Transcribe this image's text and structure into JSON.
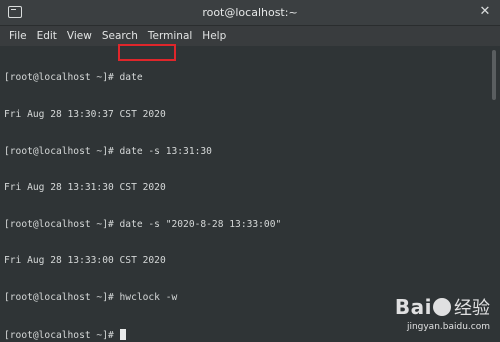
{
  "window": {
    "title": "root@localhost:~",
    "icon": "terminal-icon",
    "close_glyph": "✕"
  },
  "menu": {
    "items": [
      "File",
      "Edit",
      "View",
      "Search",
      "Terminal",
      "Help"
    ]
  },
  "terminal": {
    "lines": [
      "[root@localhost ~]# date",
      "Fri Aug 28 13:30:37 CST 2020",
      "[root@localhost ~]# date -s 13:31:30",
      "Fri Aug 28 13:31:30 CST 2020",
      "[root@localhost ~]# date -s \"2020-8-28 13:33:00\"",
      "Fri Aug 28 13:33:00 CST 2020",
      "[root@localhost ~]# hwclock -w",
      "[root@localhost ~]# "
    ],
    "highlight_color": "#e0262b"
  },
  "watermark": {
    "logo_left": "Bai",
    "logo_right": "经验",
    "site": "jingyan.baidu.com"
  }
}
